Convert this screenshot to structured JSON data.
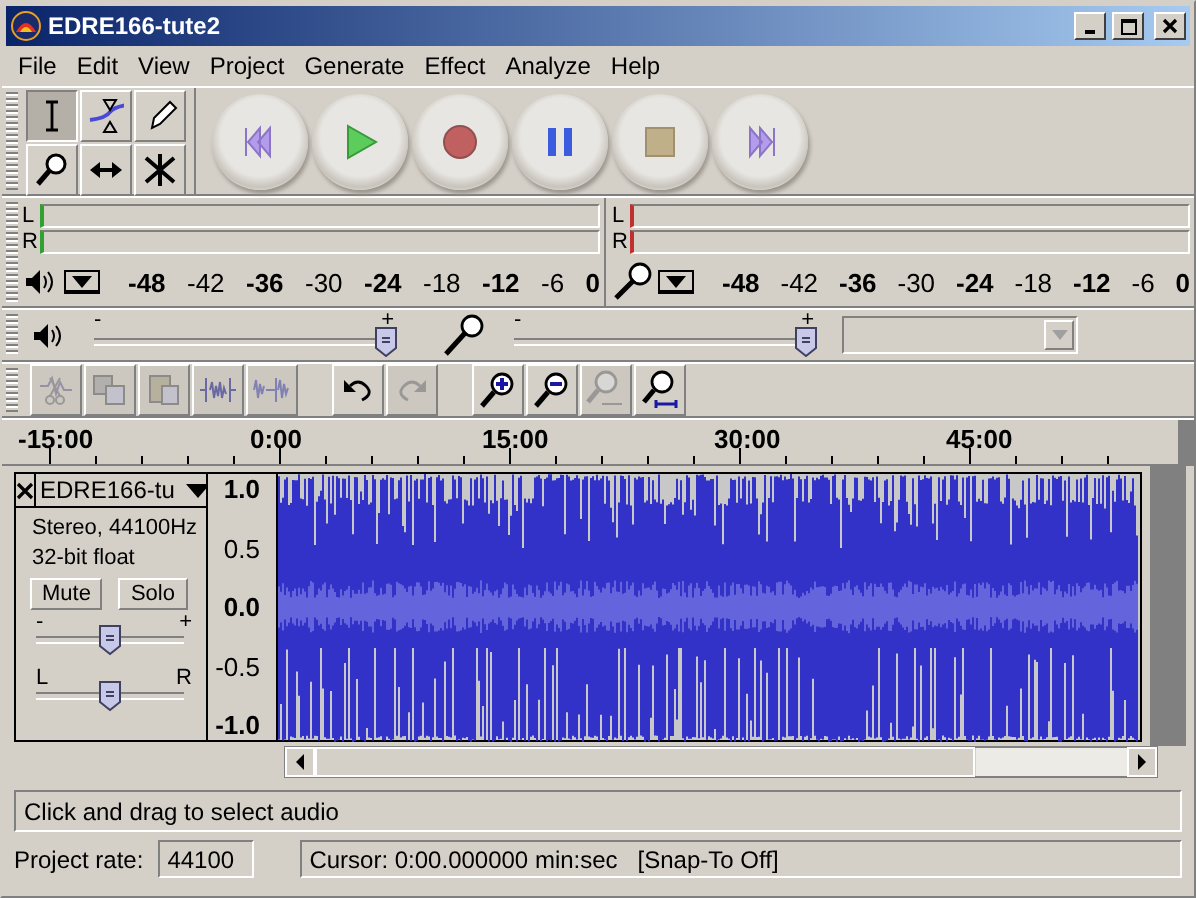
{
  "window": {
    "title": "EDRE166-tute2"
  },
  "menu": [
    "File",
    "Edit",
    "View",
    "Project",
    "Generate",
    "Effect",
    "Analyze",
    "Help"
  ],
  "tools": [
    {
      "kind": "select",
      "selected": true
    },
    {
      "kind": "envelope",
      "selected": false
    },
    {
      "kind": "draw",
      "selected": false
    },
    {
      "kind": "zoom",
      "selected": false
    },
    {
      "kind": "timeshift",
      "selected": false
    },
    {
      "kind": "multi",
      "selected": false
    }
  ],
  "transport": [
    {
      "kind": "skip-start"
    },
    {
      "kind": "play"
    },
    {
      "kind": "record"
    },
    {
      "kind": "pause"
    },
    {
      "kind": "stop"
    },
    {
      "kind": "skip-end"
    }
  ],
  "meters": [
    {
      "kind": "playback",
      "channels": [
        "L",
        "R"
      ],
      "ticks": [
        "-48",
        "-42",
        "-36",
        "-30",
        "-24",
        "-18",
        "-12",
        "-6",
        "0"
      ]
    },
    {
      "kind": "recording",
      "channels": [
        "L",
        "R"
      ],
      "ticks": [
        "-48",
        "-42",
        "-36",
        "-30",
        "-24",
        "-18",
        "-12",
        "-6",
        "0"
      ]
    }
  ],
  "mixer": {
    "output": {
      "min_label": "-",
      "max_label": "+",
      "level": 1
    },
    "input": {
      "min_label": "-",
      "max_label": "+",
      "level": 1
    },
    "input_source": {
      "disabled": true
    }
  },
  "edit_toolbar": [
    {
      "kind": "cut",
      "disabled": true
    },
    {
      "kind": "copy",
      "disabled": true
    },
    {
      "kind": "paste",
      "disabled": true
    },
    {
      "kind": "trim",
      "disabled": true
    },
    {
      "kind": "silence",
      "disabled": true
    },
    {
      "kind": "undo",
      "disabled": false
    },
    {
      "kind": "redo",
      "disabled": true
    },
    {
      "kind": "zoom-in",
      "disabled": false
    },
    {
      "kind": "zoom-out",
      "disabled": false
    },
    {
      "kind": "fit-selection",
      "disabled": true
    },
    {
      "kind": "fit-project",
      "disabled": false
    }
  ],
  "ruler": {
    "ticks": [
      "-15:00",
      "0:00",
      "15:00",
      "30:00",
      "45:00"
    ]
  },
  "track": {
    "name": "EDRE166-tu",
    "info": [
      "Stereo, 44100Hz",
      "32-bit float"
    ],
    "buttons": [
      {
        "label": "Mute",
        "on": false
      },
      {
        "label": "Solo",
        "on": false
      }
    ],
    "gain": {
      "min_label": "-",
      "max_label": "+",
      "level": 0.5
    },
    "pan": {
      "min_label": "L",
      "max_label": "R",
      "level": 0.5
    },
    "scale": [
      "1.0",
      "0.5",
      "0.0",
      "-0.5",
      "-1.0"
    ]
  },
  "status": {
    "message": "Click and drag to select audio",
    "rate_label": "Project rate:",
    "rate": "44100",
    "cursor": "Cursor: 0:00.000000 min:sec",
    "snap": "[Snap-To Off]"
  }
}
